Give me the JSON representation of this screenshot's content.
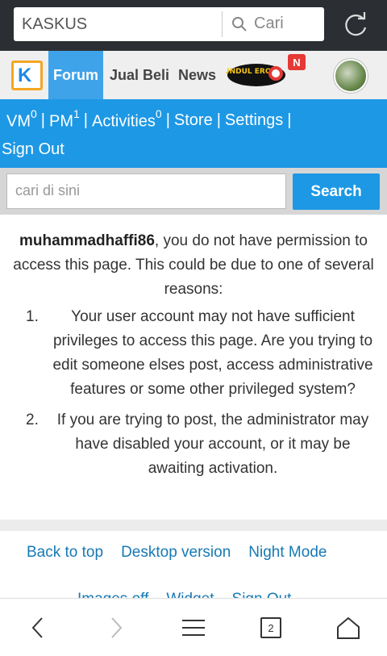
{
  "browser": {
    "url_text": "KASKUS",
    "search_placeholder": "Cari",
    "tab_count": "2"
  },
  "site_nav": {
    "logo": "K",
    "items": [
      "Forum",
      "Jual Beli",
      "News"
    ],
    "badge_new": "N",
    "banner_text": "SUNDUL EROPA"
  },
  "user_menu": {
    "vm": "VM",
    "vm_count": "0",
    "pm": "PM",
    "pm_count": "1",
    "activities": "Activities",
    "activities_count": "0",
    "store": "Store",
    "settings": "Settings",
    "sign_out": "Sign Out"
  },
  "search": {
    "placeholder": "cari di sini",
    "button": "Search"
  },
  "message": {
    "username": "muhammadhaffi86",
    "intro": ", you do not have permission to access this page. This could be due to one of several reasons:",
    "reasons": [
      {
        "num": "1.",
        "text": "Your user account may not have sufficient privileges to access this page. Are you trying to edit someone elses post, access administrative features or some other privileged system?"
      },
      {
        "num": "2.",
        "text": "If you are trying to post, the administrator may have disabled your account, or it may be awaiting activation."
      }
    ]
  },
  "footer": {
    "links": [
      "Back to top",
      "Desktop version",
      "Night Mode"
    ],
    "links2": [
      "Images off",
      "Widget",
      "Sign Out"
    ]
  },
  "colors": {
    "brand_blue": "#1d98e5",
    "link_blue": "#1779b3",
    "browser_dark": "#2b2f33"
  }
}
